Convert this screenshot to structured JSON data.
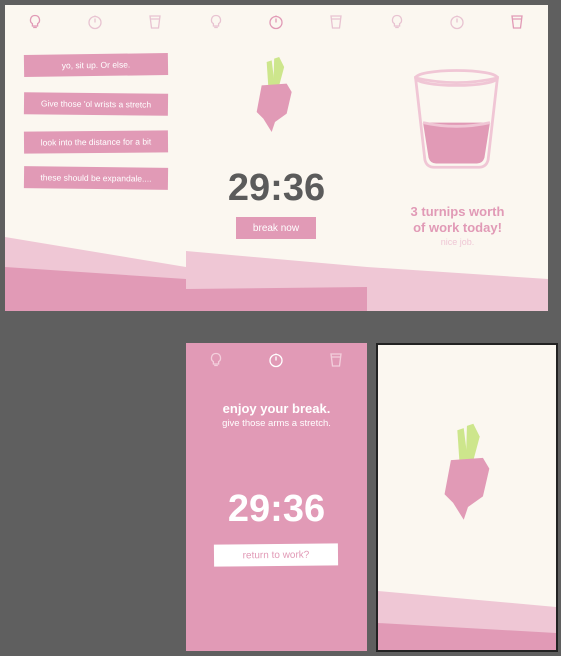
{
  "colors": {
    "canvas": "#5f5f5f",
    "cream": "#fbf7f0",
    "pink": "#e19ab6",
    "light_pink": "#efc7d5",
    "leaf_green": "#cde68c",
    "timer_gray": "#5b5b5b"
  },
  "nav_icons": [
    "lightbulb-icon",
    "timer-icon",
    "cup-icon"
  ],
  "reminders_screen": {
    "cards": [
      "yo, sit up. Or else.",
      "Give those 'ol wrists a stretch",
      "look into the distance for a bit",
      "these should be expandale...."
    ]
  },
  "work_screen": {
    "timer": "29:36",
    "button": "break now"
  },
  "stats_screen": {
    "line1": "3 turnips worth",
    "line2": "of work today!",
    "caption": "nice job."
  },
  "break_screen": {
    "title": "enjoy your break.",
    "subtitle": "give those arms a stretch.",
    "timer": "29:36",
    "button": "return to work?"
  }
}
